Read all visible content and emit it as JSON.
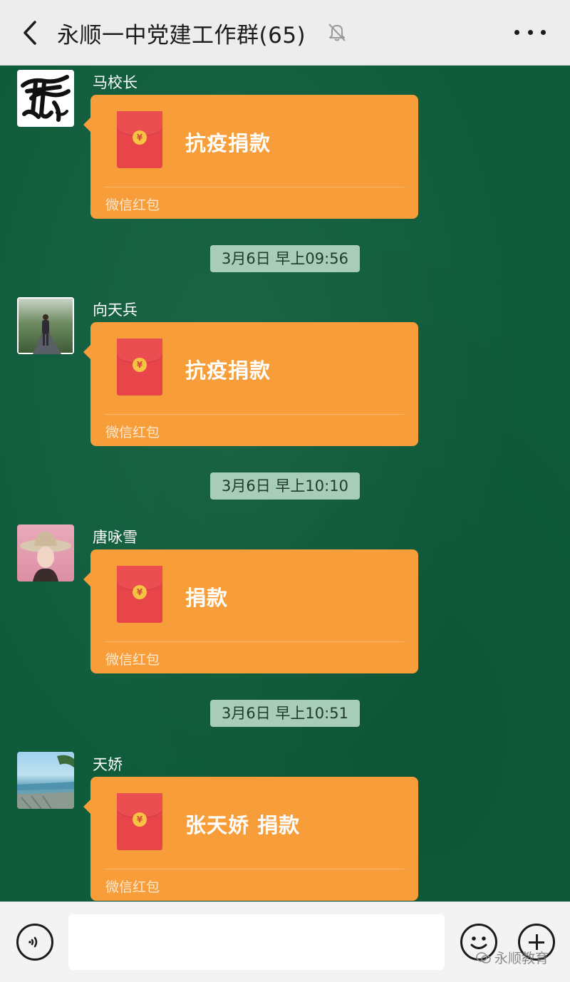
{
  "header": {
    "title": "永顺一中党建工作群(65)",
    "back_icon": "chevron-left-icon",
    "mute_icon": "bell-muted-icon",
    "more_icon": "ellipsis-icon"
  },
  "messages": [
    {
      "sender": "马校长",
      "redpacket": {
        "title": "抗疫捐款",
        "footer": "微信红包"
      }
    },
    {
      "sender": "向天兵",
      "redpacket": {
        "title": "抗疫捐款",
        "footer": "微信红包"
      }
    },
    {
      "sender": "唐咏雪",
      "redpacket": {
        "title": "捐款",
        "footer": "微信红包"
      }
    },
    {
      "sender": "天娇",
      "redpacket": {
        "title": "张天娇 捐款",
        "footer": "微信红包"
      }
    }
  ],
  "timestamps": [
    "3月6日 早上09:56",
    "3月6日 早上10:10",
    "3月6日 早上10:51"
  ],
  "coin_symbol": "¥",
  "input_bar": {
    "voice_icon": "voice-icon",
    "emoji_icon": "emoji-icon",
    "plus_icon": "plus-icon"
  },
  "watermark": "永顺教育",
  "colors": {
    "chat_bg": "#0f5c3b",
    "bubble": "#f79e3b",
    "envelope": "#e8454a",
    "timestamp_bg": "#a7cdb9"
  }
}
